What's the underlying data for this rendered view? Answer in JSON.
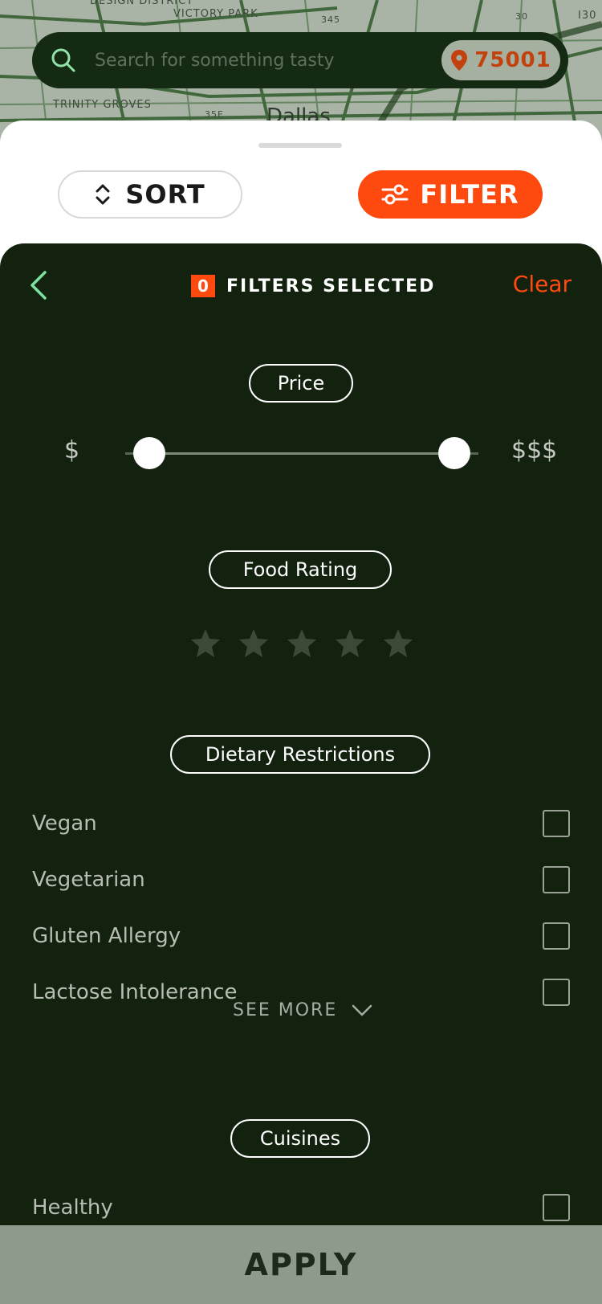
{
  "map": {
    "labels": [
      "DESIGN DISTRICT",
      "VICTORY PARK",
      "TRINITY GROVES",
      "Dallas",
      "345",
      "30",
      "35E",
      "I30"
    ]
  },
  "search": {
    "placeholder": "Search for something tasty",
    "value": "",
    "zip": "75001"
  },
  "toolbar": {
    "sort_label": "SORT",
    "filter_label": "FILTER"
  },
  "filters": {
    "count": "0",
    "title": "FILTERS SELECTED",
    "clear_label": "Clear"
  },
  "price": {
    "label": "Price",
    "min_label": "$",
    "max_label": "$$$",
    "range": [
      1,
      3
    ]
  },
  "food_rating": {
    "label": "Food Rating",
    "stars_total": 5,
    "stars_selected": 0
  },
  "dietary": {
    "label": "Dietary Restrictions",
    "options": [
      {
        "label": "Vegan",
        "checked": false
      },
      {
        "label": "Vegetarian",
        "checked": false
      },
      {
        "label": "Gluten Allergy",
        "checked": false
      },
      {
        "label": "Lactose Intolerance",
        "checked": false
      }
    ],
    "see_more_label": "SEE MORE"
  },
  "cuisines": {
    "label": "Cuisines",
    "options": [
      {
        "label": "Healthy",
        "checked": false
      }
    ]
  },
  "apply_label": "APPLY",
  "colors": {
    "accent": "#ff4a0f",
    "panel": "#12220f",
    "search_bg": "#142a12",
    "back_arrow": "#7de0a0"
  },
  "icons": {
    "search": "search-icon",
    "pin": "location-pin-icon",
    "sort": "sort-arrows-icon",
    "filter": "sliders-icon",
    "back": "chevron-left-icon",
    "star": "star-icon",
    "see_more": "chevron-down-icon"
  }
}
